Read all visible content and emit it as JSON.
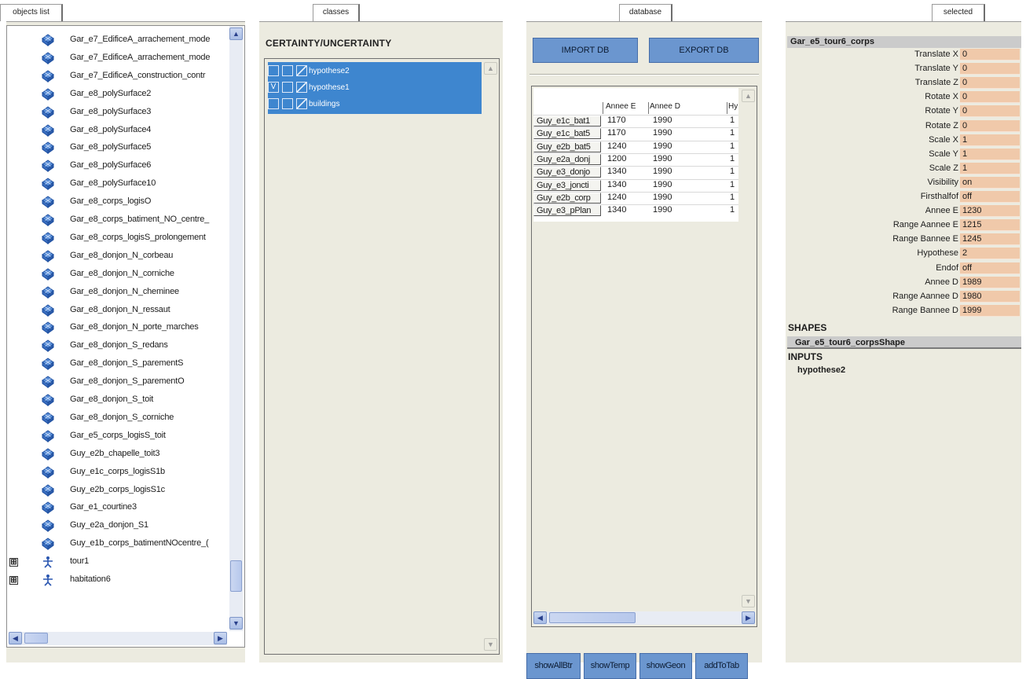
{
  "tabs": {
    "objects": "objects list",
    "classes": "classes",
    "database": "database",
    "selected": "selected"
  },
  "objects_list": [
    "Gar_e7_EdificeA_arrachement_mode",
    "Gar_e7_EdificeA_arrachement_mode",
    "Gar_e7_EdificeA_construction_contr",
    "Gar_e8_polySurface2",
    "Gar_e8_polySurface3",
    "Gar_e8_polySurface4",
    "Gar_e8_polySurface5",
    "Gar_e8_polySurface6",
    "Gar_e8_polySurface10",
    "Gar_e8_corps_logisO",
    "Gar_e8_corps_batiment_NO_centre_",
    "Gar_e8_corps_logisS_prolongement",
    "Gar_e8_donjon_N_corbeau",
    "Gar_e8_donjon_N_corniche",
    "Gar_e8_donjon_N_cheminee",
    "Gar_e8_donjon_N_ressaut",
    "Gar_e8_donjon_N_porte_marches",
    "Gar_e8_donjon_S_redans",
    "Gar_e8_donjon_S_parementS",
    "Gar_e8_donjon_S_parementO",
    "Gar_e8_donjon_S_toit",
    "Gar_e8_donjon_S_corniche",
    "Gar_e5_corps_logisS_toit",
    "Guy_e2b_chapelle_toit3",
    "Guy_e1c_corps_logisS1b",
    "Guy_e2b_corps_logisS1c",
    "Gar_e1_courtine3",
    "Guy_e2a_donjon_S1",
    "Guy_e1b_corps_batimentNOcentre_("
  ],
  "groups": [
    {
      "label": "tour1",
      "expander": "⊞"
    },
    {
      "label": "habitation6",
      "expander": "⊞"
    }
  ],
  "classes": {
    "title": "CERTAINTY/UNCERTAINTY",
    "items": [
      {
        "label": "hypothese2",
        "check": ""
      },
      {
        "label": "hypothese1",
        "check": "V"
      },
      {
        "label": "buildings",
        "check": ""
      }
    ]
  },
  "database": {
    "import_label": "IMPORT DB",
    "export_label": "EXPORT DB",
    "columns": [
      "Annee E",
      "Annee D",
      "Hy"
    ],
    "rows": [
      {
        "name": "Guy_e1c_bat1",
        "e": "1170",
        "d": "1990",
        "h": "1"
      },
      {
        "name": "Guy_e1c_bat5",
        "e": "1170",
        "d": "1990",
        "h": "1"
      },
      {
        "name": "Guy_e2b_bat5",
        "e": "1240",
        "d": "1990",
        "h": "1"
      },
      {
        "name": "Guy_e2a_donj",
        "e": "1200",
        "d": "1990",
        "h": "1"
      },
      {
        "name": "Guy_e3_donjo",
        "e": "1340",
        "d": "1990",
        "h": "1"
      },
      {
        "name": "Guy_e3_joncti",
        "e": "1340",
        "d": "1990",
        "h": "1"
      },
      {
        "name": "Guy_e2b_corp",
        "e": "1240",
        "d": "1990",
        "h": "1"
      },
      {
        "name": "Guy_e3_pPlan",
        "e": "1340",
        "d": "1990",
        "h": "1"
      }
    ],
    "buttons": [
      "showAllBtr",
      "showTemp",
      "showGeon",
      "addToTab"
    ]
  },
  "selected": {
    "title": "Gar_e5_tour6_corps",
    "attributes": [
      {
        "k": "Translate X",
        "v": "0"
      },
      {
        "k": "Translate Y",
        "v": "0"
      },
      {
        "k": "Translate Z",
        "v": "0"
      },
      {
        "k": "Rotate X",
        "v": "0"
      },
      {
        "k": "Rotate Y",
        "v": "0"
      },
      {
        "k": "Rotate Z",
        "v": "0"
      },
      {
        "k": "Scale X",
        "v": "1"
      },
      {
        "k": "Scale Y",
        "v": "1"
      },
      {
        "k": "Scale Z",
        "v": "1"
      },
      {
        "k": "Visibility",
        "v": "on"
      },
      {
        "k": "Firsthalfof",
        "v": "off"
      },
      {
        "k": "Annee E",
        "v": "1230"
      },
      {
        "k": "Range Aannee E",
        "v": "1215"
      },
      {
        "k": "Range Bannee E",
        "v": "1245"
      },
      {
        "k": "Hypothese",
        "v": "2"
      },
      {
        "k": "Endof",
        "v": "off"
      },
      {
        "k": "Annee D",
        "v": "1989"
      },
      {
        "k": "Range Aannee D",
        "v": "1980"
      },
      {
        "k": "Range Bannee D",
        "v": "1999"
      }
    ],
    "shapes_label": "SHAPES",
    "shape": "Gar_e5_tour6_corpsShape",
    "inputs_label": "INPUTS",
    "input": "hypothese2"
  },
  "icons": {
    "object": "polygon-mesh-icon",
    "group": "transform-node-icon"
  },
  "colors": {
    "panel_bg": "#ecebe0",
    "selection": "#3e86cf",
    "button": "#6b96cf",
    "attr_value": "#f0c9aa"
  }
}
